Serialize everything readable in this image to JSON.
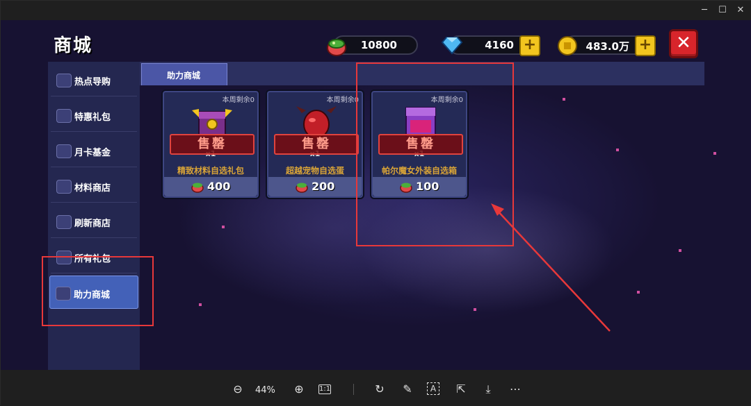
{
  "window": {
    "controls": [
      "minimize",
      "maximize",
      "close"
    ]
  },
  "shop": {
    "title": "商城",
    "currencies": [
      {
        "icon": "pet-food-bowl-icon",
        "value": "10800",
        "has_plus": false
      },
      {
        "icon": "blue-gem-icon",
        "value": "4160",
        "has_plus": true
      },
      {
        "icon": "gold-coin-icon",
        "value": "483.0万",
        "has_plus": true
      }
    ],
    "close_label": "✕",
    "sidebar": [
      {
        "label": "热点导购",
        "icon": "cart-icon",
        "active": false
      },
      {
        "label": "特惠礼包",
        "icon": "gift-box-icon",
        "active": false
      },
      {
        "label": "月卡基金",
        "icon": "card-icon",
        "active": false
      },
      {
        "label": "材料商店",
        "icon": "gem-icon",
        "active": false
      },
      {
        "label": "刷新商店",
        "icon": "hourglass-icon",
        "active": false
      },
      {
        "label": "所有礼包",
        "icon": "diamond-icon",
        "active": false
      },
      {
        "label": "助力商城",
        "icon": "helper-shop-icon",
        "active": true
      }
    ],
    "tab": "助力商城",
    "items": [
      {
        "weekly": "本周剩余0",
        "qty": "x1",
        "sold_out": "售罄",
        "name": "精致材料自选礼包",
        "price": "400",
        "image": "treasure-chest-gold"
      },
      {
        "weekly": "本周剩余0",
        "qty": "x1",
        "sold_out": "售罄",
        "name": "超越宠物自选蛋",
        "price": "200",
        "image": "red-pet-egg"
      },
      {
        "weekly": "本周剩余0",
        "qty": "x1",
        "sold_out": "售罄",
        "name": "帕尔魔女外装自选箱",
        "price": "100",
        "image": "purple-chest"
      }
    ]
  },
  "viewer_toolbar": {
    "zoom": "44%",
    "buttons": [
      "zoom-out",
      "zoom-in",
      "actual-size",
      "rotate",
      "edit",
      "text-select",
      "share",
      "download",
      "more"
    ]
  },
  "colors": {
    "annotation": "#e8383a",
    "sidebar_active": "#4361b8",
    "sold_out_border": "#e0433e",
    "item_name": "#d9a437"
  }
}
